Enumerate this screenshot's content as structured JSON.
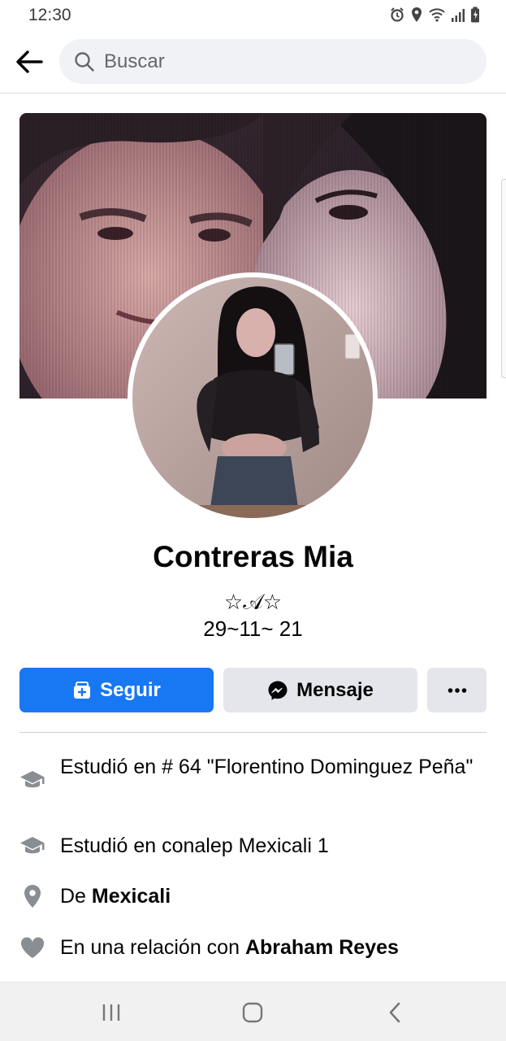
{
  "status_bar": {
    "time": "12:30",
    "icons": [
      "alarm-icon",
      "location-icon",
      "wifi-icon",
      "signal-icon",
      "battery-icon"
    ]
  },
  "search": {
    "placeholder": "Buscar"
  },
  "profile": {
    "name": "Contreras Mia",
    "bio_line1": "☆𝒜☆",
    "bio_line2": "29~11~ 21"
  },
  "actions": {
    "follow_label": "Seguir",
    "message_label": "Mensaje",
    "more_label": "···"
  },
  "details": [
    {
      "icon": "graduation-cap-icon",
      "text": "Estudió en # 64 \"Florentino Dominguez Peña\""
    },
    {
      "icon": "graduation-cap-icon",
      "text": "Estudió en conalep Mexicali 1"
    },
    {
      "icon": "location-pin-icon",
      "prefix": "De ",
      "bold": "Mexicali"
    },
    {
      "icon": "heart-icon",
      "prefix": "En una relación con ",
      "bold": "Abraham Reyes"
    }
  ],
  "colors": {
    "accent": "#1877f2",
    "button_secondary": "#e4e6eb",
    "icon_gray": "#8a8d91"
  }
}
